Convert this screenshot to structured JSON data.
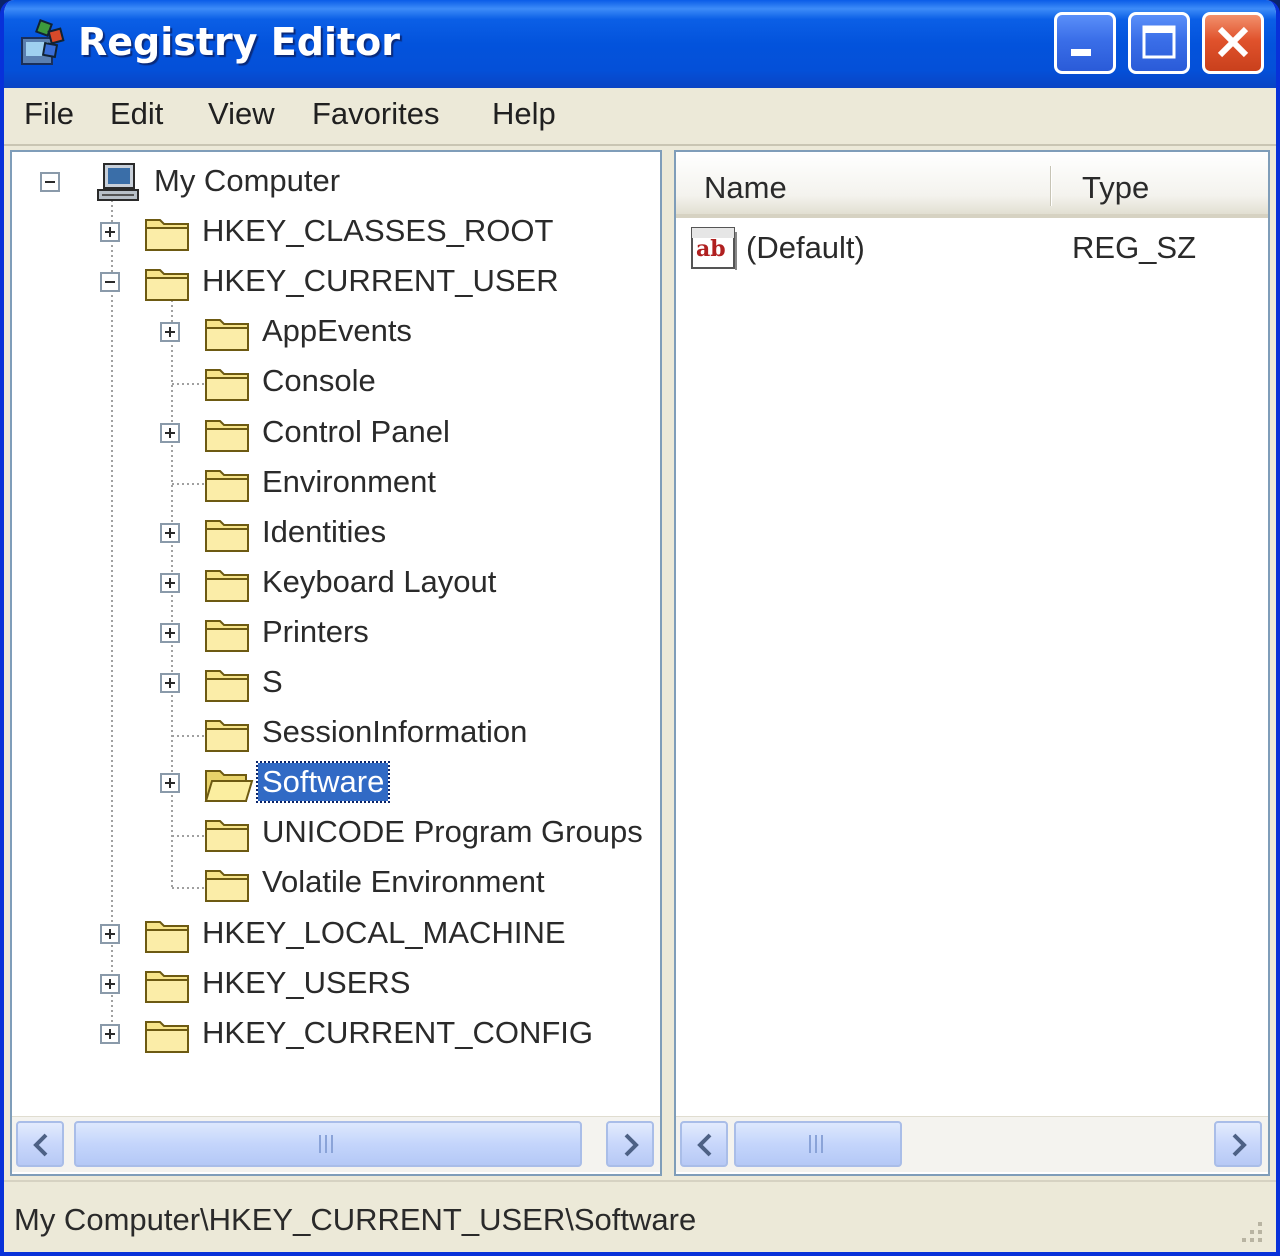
{
  "window": {
    "title": "Registry Editor",
    "colors": {
      "titlebar": "#0353dc",
      "selection": "#316ac5",
      "close_button": "#e0522c",
      "folder": "#f7e48a"
    }
  },
  "menu": {
    "items": [
      "File",
      "Edit",
      "View",
      "Favorites",
      "Help"
    ]
  },
  "tree": {
    "root": "My Computer",
    "hives": [
      "HKEY_CLASSES_ROOT",
      "HKEY_CURRENT_USER",
      "HKEY_LOCAL_MACHINE",
      "HKEY_USERS",
      "HKEY_CURRENT_CONFIG"
    ],
    "current_user_children": [
      "AppEvents",
      "Console",
      "Control Panel",
      "Environment",
      "Identities",
      "Keyboard Layout",
      "Printers",
      "S",
      "SessionInformation",
      "Software",
      "UNICODE Program Groups",
      "Volatile Environment"
    ],
    "selected": "Software"
  },
  "list": {
    "columns": [
      "Name",
      "Type"
    ],
    "rows": [
      {
        "name": "(Default)",
        "type": "REG_SZ",
        "icon": "string-value-icon"
      }
    ]
  },
  "status": {
    "path": "My Computer\\HKEY_CURRENT_USER\\Software"
  }
}
